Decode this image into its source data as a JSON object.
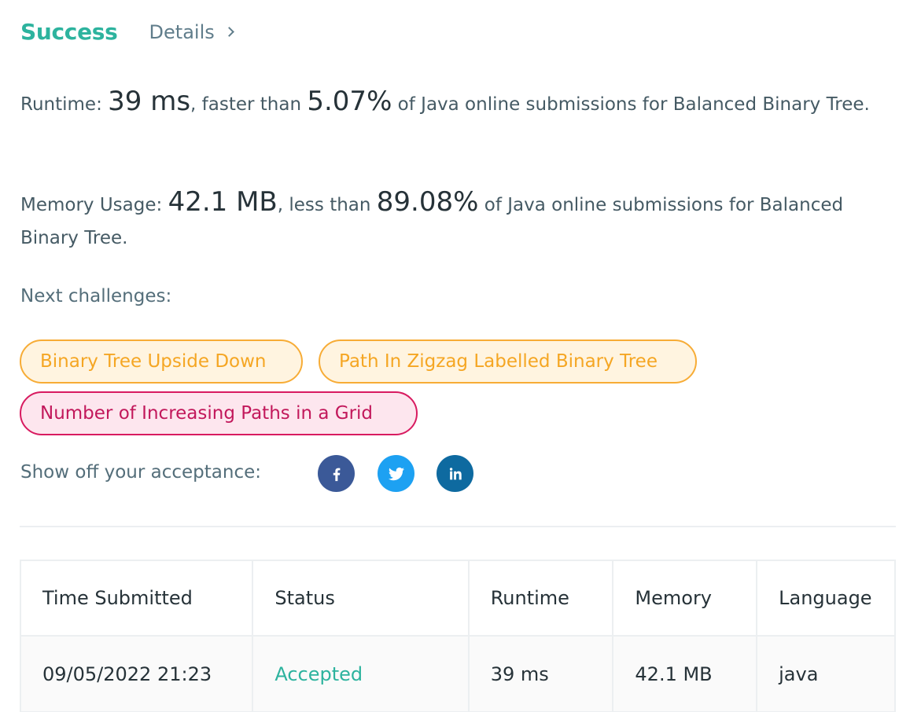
{
  "header": {
    "status": "Success",
    "details_label": "Details"
  },
  "runtime": {
    "label": "Runtime: ",
    "value": "39 ms",
    "comparison": ", faster than ",
    "percent": "5.07%",
    "suffix": " of Java online submissions for Balanced Binary Tree."
  },
  "memory": {
    "label": "Memory Usage: ",
    "value": "42.1 MB",
    "comparison": ", less than ",
    "percent": "89.08%",
    "suffix": " of Java online submissions for Balanced Binary Tree."
  },
  "next_challenges": {
    "label": "Next challenges:",
    "items": [
      {
        "title": "Binary Tree Upside Down",
        "difficulty_color": "#f5a623"
      },
      {
        "title": "Path In Zigzag Labelled Binary Tree",
        "difficulty_color": "#f5a623"
      },
      {
        "title": "Number of Increasing Paths in a Grid",
        "difficulty_color": "#c2185b"
      }
    ]
  },
  "share": {
    "label": "Show off your acceptance:",
    "icons": [
      "facebook-icon",
      "twitter-icon",
      "linkedin-icon"
    ]
  },
  "submissions_table": {
    "columns": [
      "Time Submitted",
      "Status",
      "Runtime",
      "Memory",
      "Language"
    ],
    "rows": [
      [
        "09/05/2022 21:23",
        "Accepted",
        "39 ms",
        "42.1 MB",
        "java"
      ]
    ]
  },
  "colors": {
    "success": "#2db39e",
    "medium": "#f5a623",
    "hard": "#c2185b",
    "facebook": "#3b5998",
    "twitter": "#1da1f2",
    "linkedin": "#0e6aa0"
  }
}
